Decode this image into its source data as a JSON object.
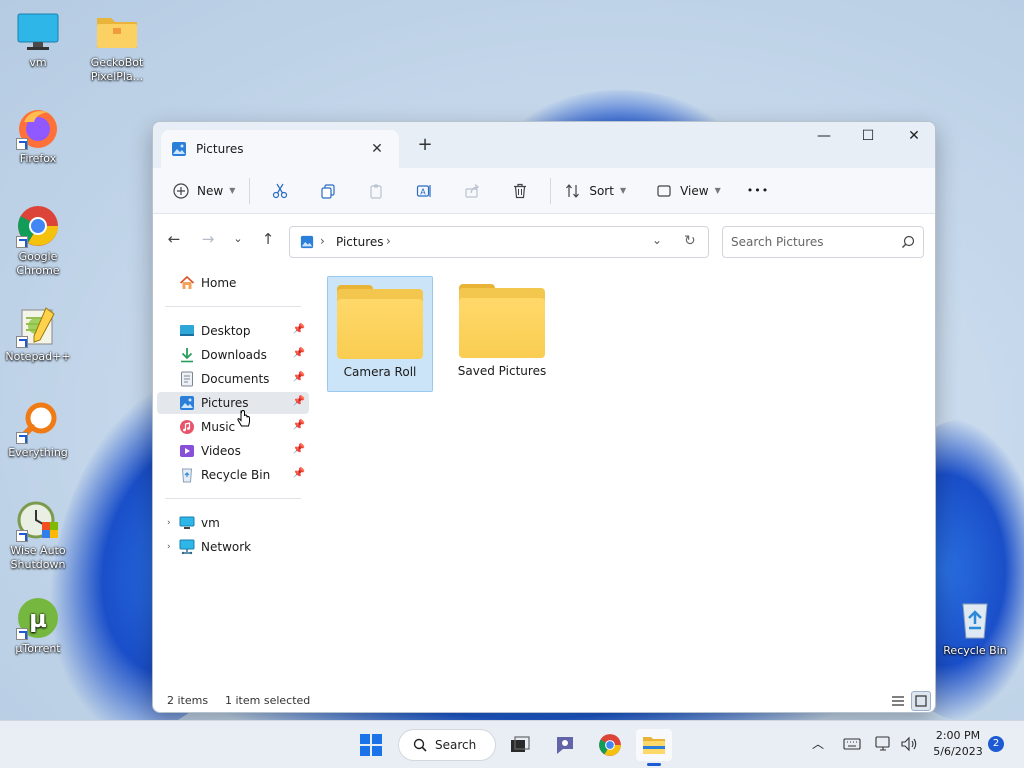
{
  "desktop": {
    "icons": [
      {
        "label": "vm",
        "icon": "monitor-icon"
      },
      {
        "label": "GeckoBot PixelPla...",
        "icon": "folder-icon"
      },
      {
        "label": "Firefox",
        "icon": "firefox-icon"
      },
      {
        "label": "Google Chrome",
        "icon": "chrome-icon"
      },
      {
        "label": "Notepad++",
        "icon": "notepad-plus-plus-icon"
      },
      {
        "label": "Everything",
        "icon": "everything-search-icon"
      },
      {
        "label": "Wise Auto Shutdown",
        "icon": "wise-auto-shutdown-icon"
      },
      {
        "label": "µTorrent",
        "icon": "utorrent-icon"
      },
      {
        "label": "Recycle Bin",
        "icon": "recycle-bin-icon"
      }
    ]
  },
  "window": {
    "tab_title": "Pictures",
    "tab_close": "✕",
    "new_tab": "+",
    "minimize": "—",
    "maximize": "☐",
    "close": "✕"
  },
  "toolbar": {
    "new_label": "New",
    "sort_label": "Sort",
    "view_label": "View",
    "more": "•••"
  },
  "address": {
    "segment": "Pictures",
    "separator": "›",
    "search_placeholder": "Search Pictures"
  },
  "nav": {
    "home": "Home",
    "pinned": [
      "Desktop",
      "Downloads",
      "Documents",
      "Pictures",
      "Music",
      "Videos",
      "Recycle Bin"
    ],
    "locations": [
      "vm",
      "Network"
    ],
    "selected": "Pictures"
  },
  "files": [
    {
      "name": "Camera Roll",
      "selected": true
    },
    {
      "name": "Saved Pictures",
      "selected": false
    }
  ],
  "status": {
    "count": "2 items",
    "selection": "1 item selected"
  },
  "taskbar": {
    "search_label": "Search",
    "time": "2:00 PM",
    "date": "5/6/2023",
    "notifications": "2"
  },
  "colors": {
    "accent": "#1e5bd2",
    "selection": "#cce4f7",
    "folder": "#f9cd51"
  }
}
